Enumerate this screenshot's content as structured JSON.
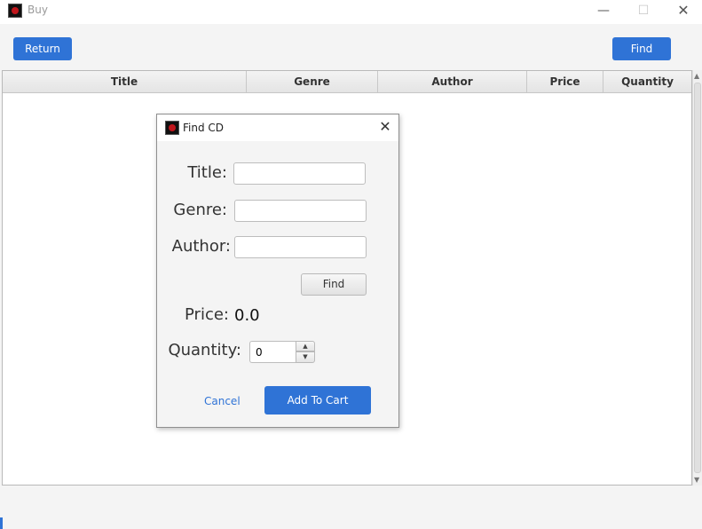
{
  "window": {
    "title": "Buy",
    "minimize_glyph": "—",
    "maximize_glyph": "☐",
    "close_glyph": "✕"
  },
  "toolbar": {
    "return_label": "Return",
    "find_label": "Find"
  },
  "table": {
    "columns": [
      "Title",
      "Genre",
      "Author",
      "Price",
      "Quantity"
    ],
    "rows": []
  },
  "dialog": {
    "title": "Find CD",
    "close_glyph": "✕",
    "title_label": "Title:",
    "title_value": "",
    "genre_label": "Genre:",
    "genre_value": "",
    "author_label": "Author:",
    "author_value": "",
    "find_label": "Find",
    "price_label": "Price:",
    "price_value": "0.0",
    "quantity_label": "Quantity:",
    "quantity_value": "0",
    "cancel_label": "Cancel",
    "add_to_cart_label": "Add To Cart"
  },
  "colors": {
    "accent": "#2f73d6",
    "window_bg": "#f4f4f4",
    "app_icon_red": "#c0161c"
  },
  "icons": {
    "app": "app-icon",
    "spinner_up": "▲",
    "spinner_down": "▼"
  }
}
